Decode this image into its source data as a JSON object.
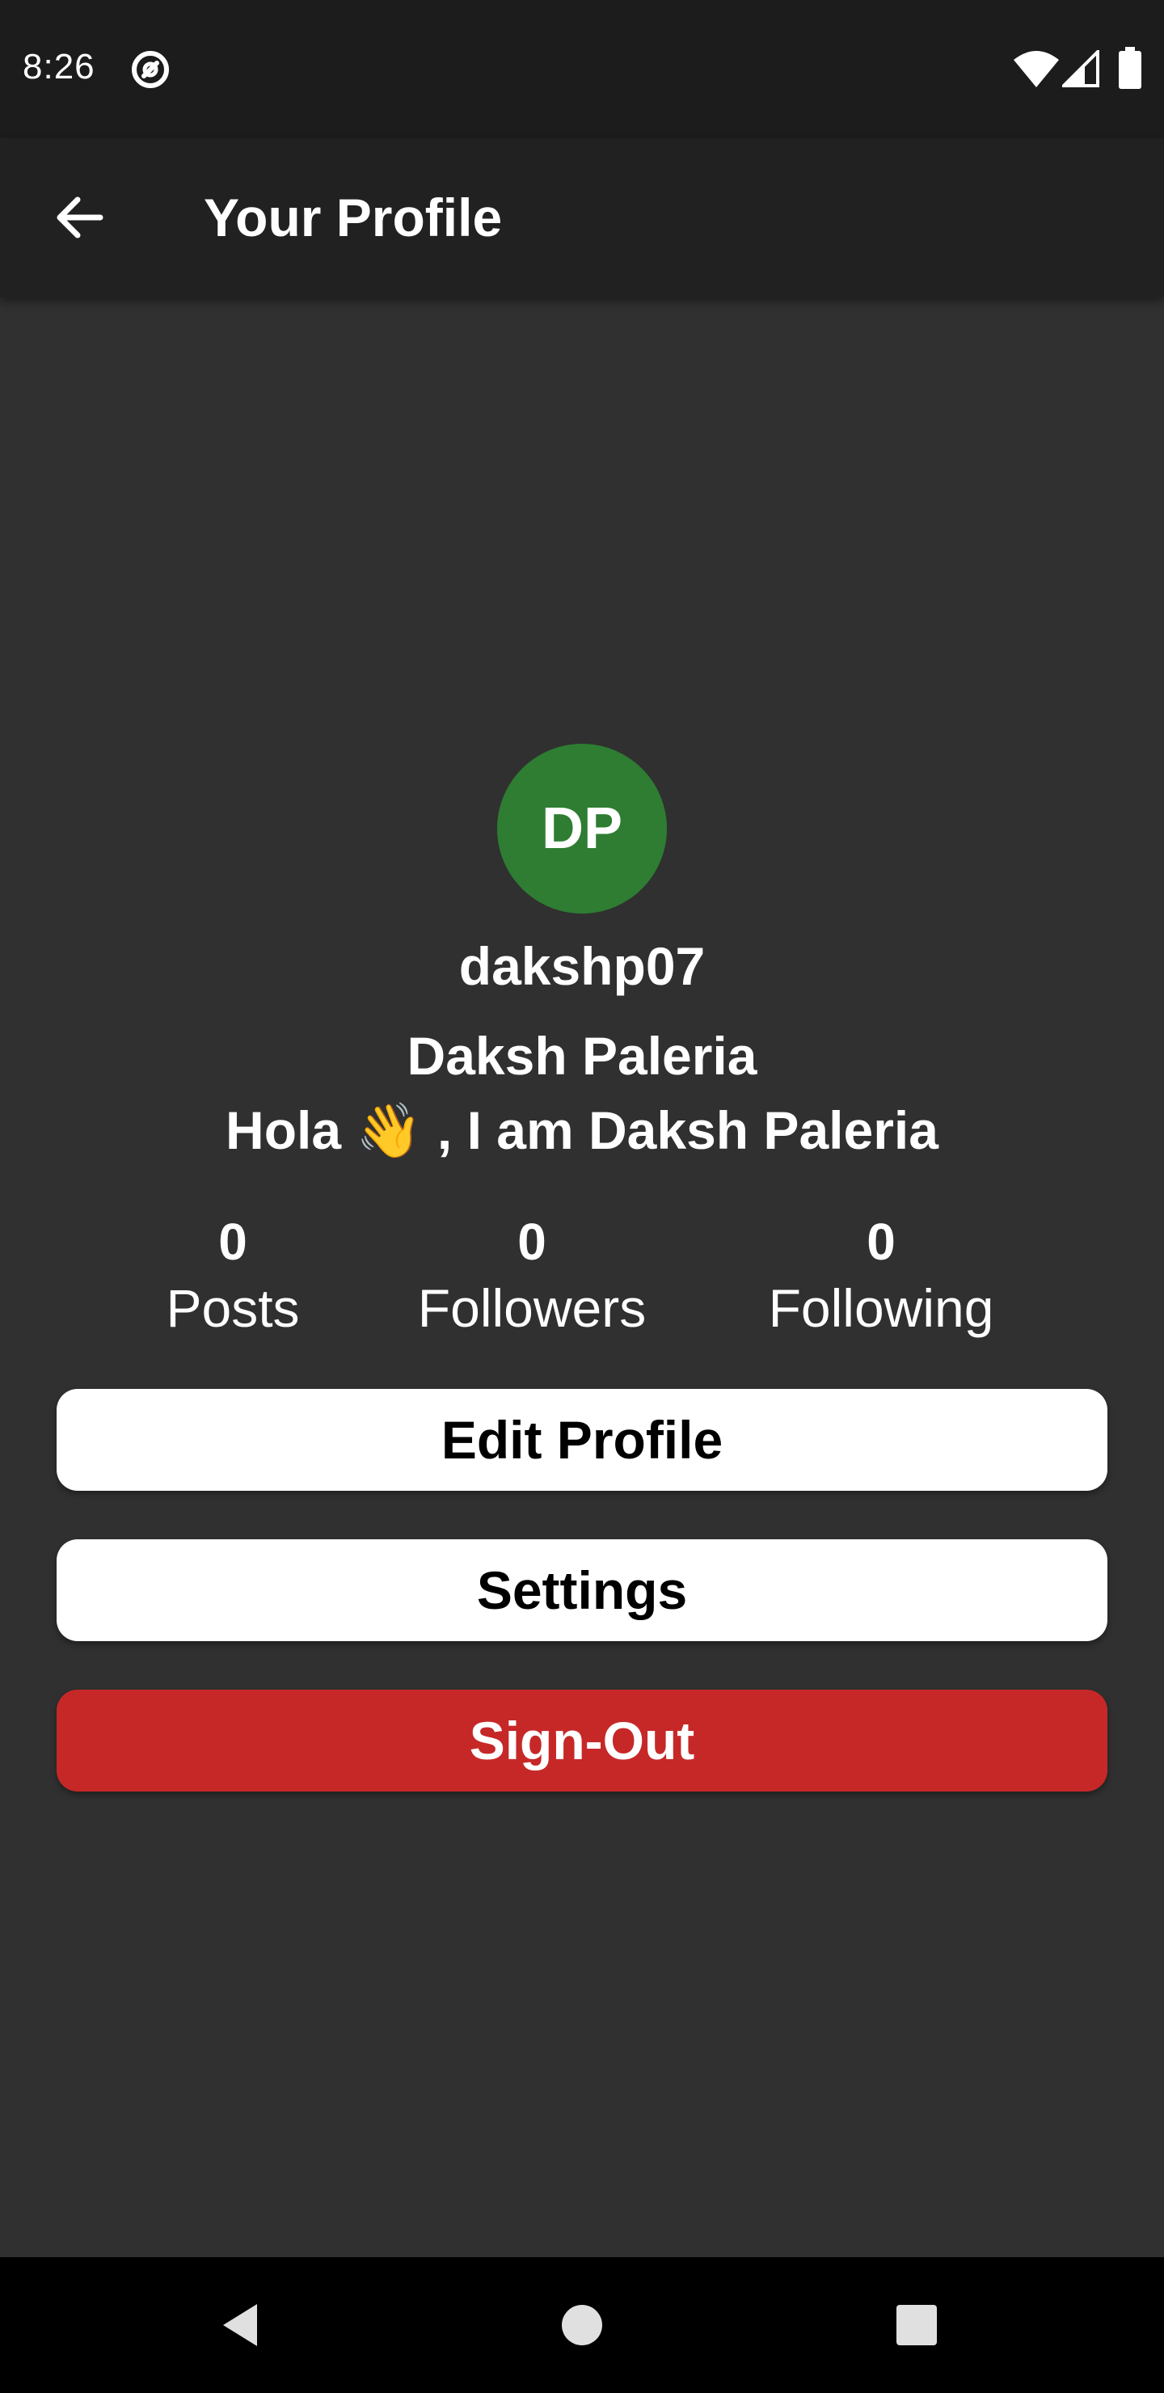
{
  "status_bar": {
    "time": "8:26",
    "icons": [
      "vpn-icon",
      "wifi-icon",
      "signal-icon",
      "battery-icon"
    ]
  },
  "app_bar": {
    "title": "Your Profile",
    "back_icon": "arrow-left-icon"
  },
  "profile": {
    "avatar_initials": "DP",
    "avatar_color": "#2e7d32",
    "username": "dakshp07",
    "full_name": "Daksh Paleria",
    "bio": "Hola 👋 , I am Daksh Paleria"
  },
  "stats": [
    {
      "count": "0",
      "label": "Posts"
    },
    {
      "count": "0",
      "label": "Followers"
    },
    {
      "count": "0",
      "label": "Following"
    }
  ],
  "actions": {
    "edit_profile": "Edit Profile",
    "settings": "Settings",
    "sign_out": "Sign-Out",
    "sign_out_color": "#c62828"
  },
  "nav_bar": {
    "icons": [
      "back-triangle-icon",
      "home-circle-icon",
      "recents-square-icon"
    ]
  }
}
